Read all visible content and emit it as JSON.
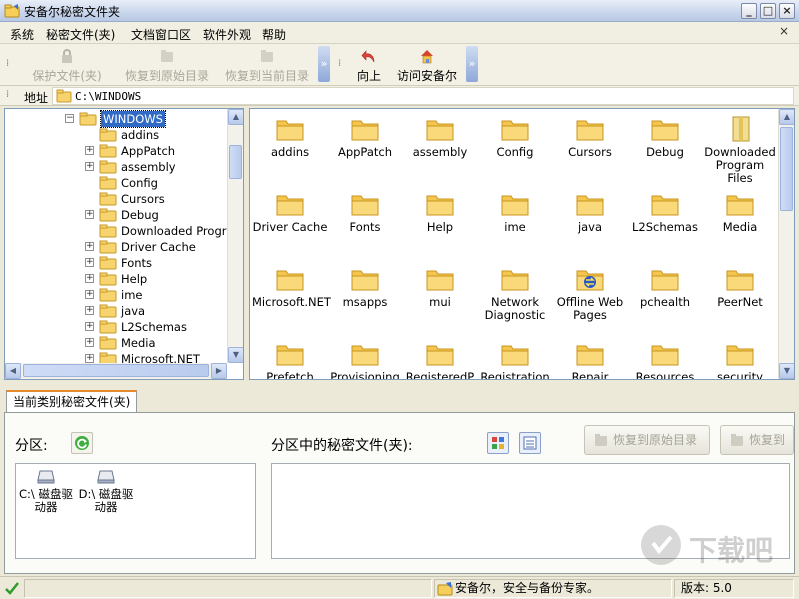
{
  "window": {
    "title": "安备尔秘密文件夹",
    "min_label": "_",
    "max_label": "□",
    "close_label": "×"
  },
  "menu": {
    "items": [
      "系统",
      "秘密文件(夹)",
      "文档窗口区",
      "软件外观",
      "帮助"
    ],
    "close_label": "×"
  },
  "toolbar": {
    "protect": "保护文件(夹)",
    "restore_original": "恢复到原始目录",
    "restore_current": "恢复到当前目录",
    "up": "向上",
    "visit": "访问安备尔"
  },
  "address": {
    "label": "地址",
    "path": "C:\\WINDOWS"
  },
  "tree": {
    "items": [
      {
        "label": "WINDOWS",
        "expander": "−",
        "selected": true
      },
      {
        "label": "addins",
        "expander": ""
      },
      {
        "label": "AppPatch",
        "expander": "+"
      },
      {
        "label": "assembly",
        "expander": "+"
      },
      {
        "label": "Config",
        "expander": ""
      },
      {
        "label": "Cursors",
        "expander": ""
      },
      {
        "label": "Debug",
        "expander": "+"
      },
      {
        "label": "Downloaded Program",
        "expander": ""
      },
      {
        "label": "Driver Cache",
        "expander": "+"
      },
      {
        "label": "Fonts",
        "expander": "+"
      },
      {
        "label": "Help",
        "expander": "+"
      },
      {
        "label": "ime",
        "expander": "+"
      },
      {
        "label": "java",
        "expander": "+"
      },
      {
        "label": "L2Schemas",
        "expander": "+"
      },
      {
        "label": "Media",
        "expander": "+"
      },
      {
        "label": "Microsoft.NET",
        "expander": "+"
      }
    ]
  },
  "folders": [
    "addins",
    "AppPatch",
    "assembly",
    "Config",
    "Cursors",
    "Debug",
    "Downloaded Program Files",
    "Driver Cache",
    "Fonts",
    "Help",
    "ime",
    "java",
    "L2Schemas",
    "Media",
    "Microsoft.NET",
    "msapps",
    "mui",
    "Network Diagnostic",
    "Offline Web Pages",
    "pchealth",
    "PeerNet",
    "Prefetch",
    "Provisioning",
    "RegisteredP",
    "Registration",
    "Repair",
    "Resources",
    "security"
  ],
  "lower": {
    "tab": "当前类别秘密文件(夹)",
    "partition_label": "分区:",
    "files_label": "分区中的秘密文件(夹):",
    "restore_original": "恢复到原始目录",
    "restore_cut": "恢复到",
    "drives": [
      {
        "letter": "C:\\",
        "name": "磁盘驱动器"
      },
      {
        "letter": "D:\\",
        "name": "磁盘驱动器"
      }
    ]
  },
  "status": {
    "slogan": "安备尔，安全与备份专家。",
    "version": "版本: 5.0"
  },
  "watermark": "下载吧"
}
